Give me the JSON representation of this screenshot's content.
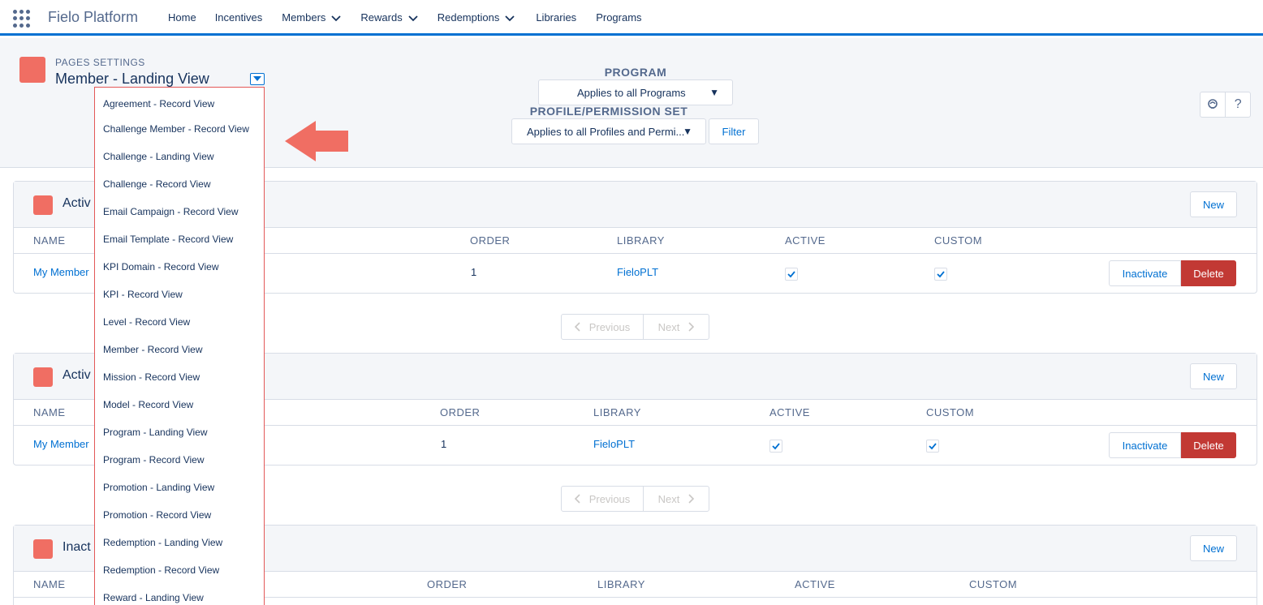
{
  "app": {
    "name": "Fielo Platform"
  },
  "nav": {
    "items": [
      {
        "label": "Home",
        "has_menu": false
      },
      {
        "label": "Incentives",
        "has_menu": false
      },
      {
        "label": "Members",
        "has_menu": true
      },
      {
        "label": "Rewards",
        "has_menu": true
      },
      {
        "label": "Redemptions",
        "has_menu": true
      },
      {
        "label": "Libraries",
        "has_menu": false
      },
      {
        "label": "Programs",
        "has_menu": false
      }
    ]
  },
  "header": {
    "eyebrow": "PAGES SETTINGS",
    "title": "Member - Landing View",
    "program_label": "PROGRAM",
    "program_value": "Applies to all Programs",
    "profile_label": "PROFILE/PERMISSION SET",
    "profile_value": "Applies to all Profiles and Permi...",
    "filter_label": "Filter",
    "help_icon_label": "?"
  },
  "dropdown": {
    "options": [
      "Agreement - Record View",
      "Challenge Member - Record View",
      "Challenge - Landing View",
      "Challenge - Record View",
      "Email Campaign - Record View",
      "Email Template - Record View",
      "KPI Domain - Record View",
      "KPI - Record View",
      "Level - Record View",
      "Member - Record View",
      "Mission - Record View",
      "Model - Record View",
      "Program - Landing View",
      "Program - Record View",
      "Promotion - Landing View",
      "Promotion - Record View",
      "Redemption - Landing View",
      "Redemption - Record View",
      "Reward - Landing View"
    ]
  },
  "cards": [
    {
      "title": "Activ",
      "new_label": "New",
      "columns": {
        "name": "NAME",
        "order": "ORDER",
        "library": "LIBRARY",
        "active": "ACTIVE",
        "custom": "CUSTOM"
      },
      "row": {
        "name": "My Member",
        "order": "1",
        "library": "FieloPLT",
        "active": true,
        "custom": true
      },
      "inactivate_label": "Inactivate",
      "delete_label": "Delete",
      "pager": {
        "prev": "Previous",
        "next": "Next"
      }
    },
    {
      "title": "Activ",
      "new_label": "New",
      "columns": {
        "name": "NAME",
        "order": "ORDER",
        "library": "LIBRARY",
        "active": "ACTIVE",
        "custom": "CUSTOM"
      },
      "row": {
        "name": "My Member",
        "order": "1",
        "library": "FieloPLT",
        "active": true,
        "custom": true
      },
      "inactivate_label": "Inactivate",
      "delete_label": "Delete",
      "pager": {
        "prev": "Previous",
        "next": "Next"
      }
    },
    {
      "title": "Inact",
      "new_label": "New",
      "columns": {
        "name": "NAME",
        "order": "ORDER",
        "library": "LIBRARY",
        "active": "ACTIVE",
        "custom": "CUSTOM"
      }
    }
  ],
  "colors": {
    "brand": "#0070d2",
    "icon_tile": "#f06e63",
    "delete": "#c23934",
    "annotation_arrow": "#f06e63"
  },
  "icons": {
    "app_launcher": "waffle-icon",
    "nav_menu": "chevron-down-icon",
    "title_menu": "caret-down-icon",
    "settings": "brain-icon",
    "help": "help-icon",
    "pager_prev": "chevron-left-icon",
    "pager_next": "chevron-right-icon",
    "annotation": "left-arrow-icon"
  }
}
